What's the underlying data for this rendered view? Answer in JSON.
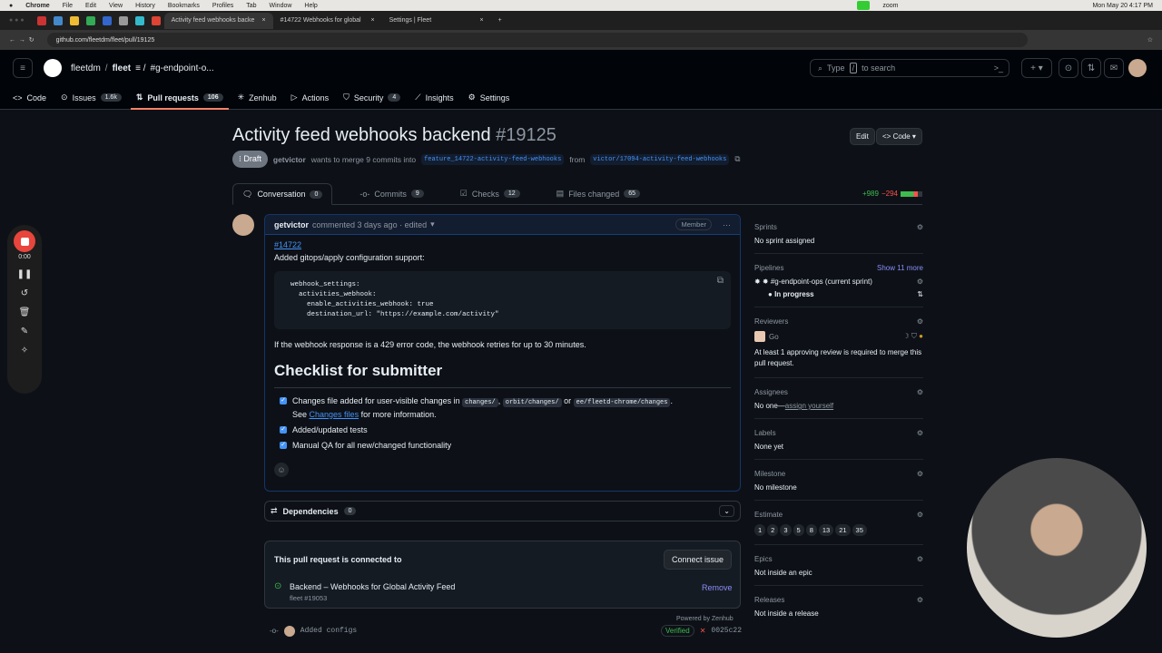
{
  "os_menu": {
    "app": "Chrome",
    "items": [
      "File",
      "Edit",
      "View",
      "History",
      "Bookmarks",
      "Profiles",
      "Tab",
      "Window",
      "Help"
    ],
    "zoom": "zoom",
    "clock": "Mon May 20  4:17 PM"
  },
  "browser": {
    "tabs": [
      {
        "title": "Activity feed webhooks backe",
        "active": true
      },
      {
        "title": "#14722 Webhooks for global",
        "active": false
      },
      {
        "title": "Settings | Fleet",
        "active": false
      }
    ],
    "url": "github.com/fleetdm/fleet/pull/19125"
  },
  "header": {
    "owner": "fleetdm",
    "repo": "fleet",
    "project": "#g-endpoint-o...",
    "search_prefix": "Type",
    "search_key": "/",
    "search_suffix": "to search"
  },
  "repo_nav": [
    {
      "label": "Code",
      "icon": "code-icon"
    },
    {
      "label": "Issues",
      "count": "1.6k",
      "icon": "issue-icon"
    },
    {
      "label": "Pull requests",
      "count": "106",
      "icon": "pr-icon",
      "selected": true
    },
    {
      "label": "Zenhub",
      "icon": "zenhub-icon"
    },
    {
      "label": "Actions",
      "icon": "play-icon"
    },
    {
      "label": "Security",
      "count": "4",
      "icon": "shield-icon"
    },
    {
      "label": "Insights",
      "icon": "graph-icon"
    },
    {
      "label": "Settings",
      "icon": "gear-icon"
    }
  ],
  "pr": {
    "title": "Activity feed webhooks backend",
    "number": "#19125",
    "edit": "Edit",
    "code": "Code",
    "state": "Draft",
    "author": "getvictor",
    "merge_text": "wants to merge 9 commits into",
    "base": "feature_14722-activity-feed-webhooks",
    "from": "from",
    "head": "victor/17094-activity-feed-webhooks",
    "additions": "+989",
    "deletions": "−294"
  },
  "pr_tabs": [
    {
      "label": "Conversation",
      "count": "0"
    },
    {
      "label": "Commits",
      "count": "9"
    },
    {
      "label": "Checks",
      "count": "12"
    },
    {
      "label": "Files changed",
      "count": "65"
    }
  ],
  "comment": {
    "author": "getvictor",
    "meta": "commented 3 days ago · edited",
    "role": "Member",
    "issue_link": "#14722",
    "intro": "Added gitops/apply configuration support:",
    "code": "webhook_settings:\n  activities_webhook:\n    enable_activities_webhook: true\n    destination_url: \"https://example.com/activity\"",
    "retry_note": "If the webhook response is a 429 error code, the webhook retries for up to 30 minutes.",
    "heading": "Checklist for submitter",
    "check1_a": "Changes file added for user-visible changes in",
    "code1": "changes/",
    "code2": "orbit/changes/",
    "or": "or",
    "code3": "ee/fleetd-chrome/changes",
    "see": "See",
    "see_link": "Changes files",
    "see_rest": "for more information.",
    "check2": "Added/updated tests",
    "check3": "Manual QA for all new/changed functionality"
  },
  "dependencies": {
    "label": "Dependencies",
    "count": "0"
  },
  "zenhub": {
    "connected": "This pull request is connected to",
    "connect_btn": "Connect issue",
    "issue_title": "Backend – Webhooks for Global Activity Feed",
    "issue_ref": "fleet #19053",
    "remove": "Remove",
    "powered": "Powered by Zenhub"
  },
  "commit": {
    "message": "Added configs",
    "verified": "Verified",
    "sha": "0025c22"
  },
  "sidebar": {
    "sprints": {
      "label": "Sprints",
      "value": "No sprint assigned"
    },
    "pipelines": {
      "label": "Pipelines",
      "more": "Show 11 more",
      "pipeline": "#g-endpoint-ops (current sprint)",
      "status": "In progress"
    },
    "reviewers": {
      "label": "Reviewers",
      "name": "Go",
      "note": "At least 1 approving review is required to merge this pull request."
    },
    "assignees": {
      "label": "Assignees",
      "value": "No one—",
      "link": "assign yourself"
    },
    "labels": {
      "label": "Labels",
      "value": "None yet"
    },
    "milestone": {
      "label": "Milestone",
      "value": "No milestone"
    },
    "estimate": {
      "label": "Estimate",
      "values": [
        "1",
        "2",
        "3",
        "5",
        "8",
        "13",
        "21",
        "35"
      ]
    },
    "epics": {
      "label": "Epics",
      "value": "Not inside an epic"
    },
    "releases": {
      "label": "Releases",
      "value": "Not inside a release"
    }
  },
  "recorder": {
    "time": "0:00"
  },
  "colors": {
    "accent": "#4493f8",
    "selected_tab": "#f78166",
    "draft": "#6e7681",
    "record": "#e8453c",
    "additions": "#3fb950",
    "deletions": "#f85149"
  }
}
